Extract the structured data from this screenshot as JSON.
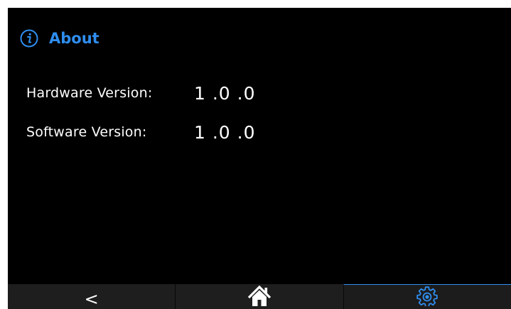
{
  "header": {
    "title": "About",
    "icon": "info-icon",
    "accent_color": "#2f8ef0"
  },
  "versions": [
    {
      "label": "Hardware Version:",
      "value": "1 .0 .0"
    },
    {
      "label": "Software Version:",
      "value": "1 .0 .0"
    }
  ],
  "navbar": {
    "back_label": "<",
    "home_icon": "home-icon",
    "settings_icon": "gear-icon",
    "active": "settings"
  }
}
